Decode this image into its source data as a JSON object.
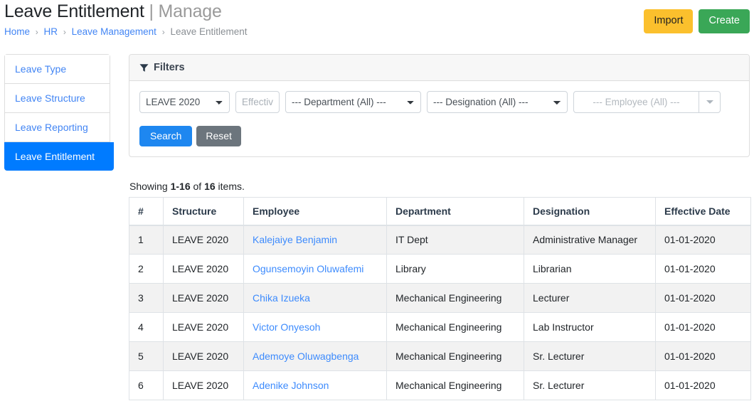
{
  "header": {
    "title": "Leave Entitlement",
    "title_separator": "|",
    "subtitle": "Manage",
    "breadcrumb": [
      {
        "label": "Home",
        "link": true
      },
      {
        "label": "HR",
        "link": true
      },
      {
        "label": "Leave Management",
        "link": true
      },
      {
        "label": "Leave Entitlement",
        "link": false
      }
    ],
    "breadcrumb_separator": "›",
    "actions": {
      "import_label": "Import",
      "create_label": "Create",
      "import_color": "#fbc02d",
      "create_color": "#3aa757"
    }
  },
  "sidebar": {
    "items": [
      {
        "label": "Leave Type",
        "active": false
      },
      {
        "label": "Leave Structure",
        "active": false
      },
      {
        "label": "Leave Reporting",
        "active": false
      },
      {
        "label": "Leave Entitlement",
        "active": true
      }
    ],
    "active_color": "#007bff",
    "link_color": "#4285f4"
  },
  "filters": {
    "panel_title": "Filters",
    "icon": "funnel-icon",
    "structure": {
      "value": "LEAVE 2020"
    },
    "effective": {
      "placeholder": "Effective Date",
      "value": ""
    },
    "department": {
      "value": "--- Department (All) ---"
    },
    "designation": {
      "value": "--- Designation (All) ---"
    },
    "employee": {
      "placeholder": "--- Employee (All) ---"
    },
    "search_label": "Search",
    "reset_label": "Reset"
  },
  "summary": {
    "prefix": "Showing ",
    "range": "1-16",
    "middle": " of ",
    "total": "16",
    "suffix": " items."
  },
  "table": {
    "columns": [
      "#",
      "Structure",
      "Employee",
      "Department",
      "Designation",
      "Effective Date"
    ],
    "rows": [
      {
        "num": "1",
        "structure": "LEAVE 2020",
        "employee": "Kalejaiye Benjamin",
        "department": "IT Dept",
        "designation": "Administrative Manager",
        "effective_date": "01-01-2020"
      },
      {
        "num": "2",
        "structure": "LEAVE 2020",
        "employee": "Ogunsemoyin Oluwafemi",
        "department": "Library",
        "designation": "Librarian",
        "effective_date": "01-01-2020"
      },
      {
        "num": "3",
        "structure": "LEAVE 2020",
        "employee": "Chika Izueka",
        "department": "Mechanical Engineering",
        "designation": "Lecturer",
        "effective_date": "01-01-2020"
      },
      {
        "num": "4",
        "structure": "LEAVE 2020",
        "employee": "Victor Onyesoh",
        "department": "Mechanical Engineering",
        "designation": "Lab Instructor",
        "effective_date": "01-01-2020"
      },
      {
        "num": "5",
        "structure": "LEAVE 2020",
        "employee": "Ademoye Oluwagbenga",
        "department": "Mechanical Engineering",
        "designation": "Sr. Lecturer",
        "effective_date": "01-01-2020"
      },
      {
        "num": "6",
        "structure": "LEAVE 2020",
        "employee": "Adenike Johnson",
        "department": "Mechanical Engineering",
        "designation": "Sr. Lecturer",
        "effective_date": "01-01-2020"
      }
    ]
  }
}
